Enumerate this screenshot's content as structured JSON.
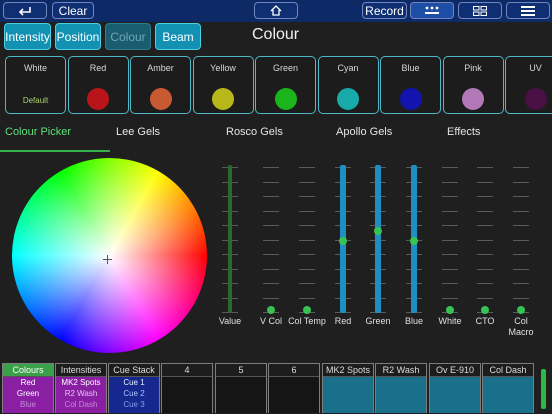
{
  "toolbar": {
    "back_icon": "return-arrow-icon",
    "clear_label": "Clear",
    "home_icon": "home-icon",
    "record_label": "Record",
    "selection_icon": "fixture-group-icon",
    "grid_icon": "grid-icon",
    "menu_icon": "hamburger-menu-icon"
  },
  "attribute_tabs": [
    {
      "label": "Intensity",
      "active": false
    },
    {
      "label": "Position",
      "active": false
    },
    {
      "label": "Colour",
      "active": true
    },
    {
      "label": "Beam",
      "active": false
    }
  ],
  "page_title": "Colour",
  "presets": [
    {
      "name": "White",
      "sub": "Default",
      "color": null
    },
    {
      "name": "Red",
      "color": "#b8141a"
    },
    {
      "name": "Amber",
      "color": "#c85a33"
    },
    {
      "name": "Yellow",
      "color": "#b8b81a"
    },
    {
      "name": "Green",
      "color": "#1bb51b"
    },
    {
      "name": "Cyan",
      "color": "#18a9a9"
    },
    {
      "name": "Blue",
      "color": "#1313b0"
    },
    {
      "name": "Pink",
      "color": "#b278b8"
    },
    {
      "name": "UV",
      "color": "#4a0f45"
    }
  ],
  "picker_tabs": [
    {
      "label": "Colour Picker",
      "active": true
    },
    {
      "label": "Lee Gels",
      "active": false
    },
    {
      "label": "Rosco Gels",
      "active": false
    },
    {
      "label": "Apollo Gels",
      "active": false
    },
    {
      "label": "Effects",
      "active": false
    }
  ],
  "faders": [
    {
      "label": "Value",
      "level": null,
      "style": "green"
    },
    {
      "label": "V Col",
      "level": 0.02,
      "style": "none"
    },
    {
      "label": "Col Temp",
      "level": 0.02,
      "style": "none"
    },
    {
      "label": "Red",
      "level": 0.5,
      "style": "blue"
    },
    {
      "label": "Green",
      "level": 0.57,
      "style": "blue"
    },
    {
      "label": "Blue",
      "level": 0.5,
      "style": "blue"
    },
    {
      "label": "White",
      "level": 0.02,
      "style": "none"
    },
    {
      "label": "CTO",
      "level": 0.02,
      "style": "none"
    },
    {
      "label": "Col Macro",
      "level": 0.02,
      "style": "none"
    }
  ],
  "playbacks": [
    {
      "title": "Colours",
      "lines": [
        "Red",
        "Green",
        "Blue"
      ],
      "theme": "c-green",
      "line_colors": [
        "#ffffff",
        "#ffffff",
        "#c58ad6"
      ]
    },
    {
      "title": "Intensities",
      "lines": [
        "MK2 Spots",
        "R2 Wash",
        "Col Dash"
      ],
      "theme": "c-purple",
      "line_colors": [
        "#ffffff",
        "#e0c4ec",
        "#c58ad6"
      ]
    },
    {
      "title": "Cue Stack",
      "lines": [
        "Cue 1",
        "Cue 2",
        "Cue 3"
      ],
      "theme": "c-blue",
      "line_colors": [
        "#e8f0ff",
        "#a6c6ff",
        "#7f9ee6"
      ]
    },
    {
      "title": "4",
      "lines": [],
      "theme": "c-dark"
    },
    {
      "title": "5",
      "lines": [],
      "theme": "c-dark"
    },
    {
      "title": "6",
      "lines": [],
      "theme": "c-dark"
    },
    {
      "title": "MK2 Spots",
      "lines": [],
      "theme": "c-cyan"
    },
    {
      "title": "R2 Wash",
      "lines": [],
      "theme": "c-cyan"
    },
    {
      "title": "Ov E-910",
      "lines": [],
      "theme": "c-cyan"
    },
    {
      "title": "Col Dash",
      "lines": [],
      "theme": "c-cyan"
    }
  ]
}
